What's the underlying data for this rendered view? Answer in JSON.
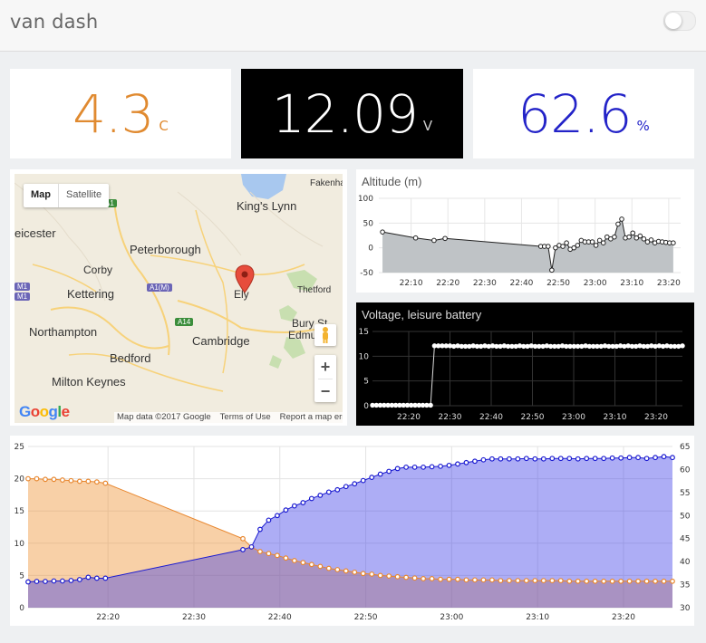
{
  "header": {
    "title": "van dash"
  },
  "stats": {
    "temperature": {
      "value": "4.3",
      "unit": "C",
      "color": "#e08a30"
    },
    "voltage": {
      "value": "12.09",
      "unit": "V",
      "color": "#ffffff",
      "bg": "#000000"
    },
    "humidity": {
      "value": "62.6",
      "unit": "%",
      "color": "#2323c8"
    }
  },
  "map": {
    "type_controls": {
      "map": "Map",
      "satellite": "Satellite"
    },
    "zoom_in": "+",
    "zoom_out": "−",
    "logo": [
      "G",
      "o",
      "o",
      "g",
      "l",
      "e"
    ],
    "footer": {
      "data": "Map data ©2017 Google",
      "terms": "Terms of Use",
      "report": "Report a map error"
    },
    "places": {
      "fakenham": "Fakenha",
      "kings_lynn": "King's Lynn",
      "leicester": "eicester",
      "peterborough": "Peterborough",
      "corby": "Corby",
      "kettering": "Kettering",
      "thetford": "Thetford",
      "ely": "Ely",
      "northampton": "Northampton",
      "bury": "Bury St",
      "bury2": "Edmu",
      "cambridge": "Cambridge",
      "bedford": "Bedford",
      "milton_keynes": "Milton Keynes"
    },
    "shields": {
      "a1": "A1",
      "a1m": "A1(M)",
      "a14": "A14",
      "m1": "M1",
      "m1b": "M1"
    }
  },
  "altitude": {
    "title": "Altitude (m)",
    "chart_data": {
      "type": "area",
      "title": "Altitude (m)",
      "ylim": [
        -50,
        100
      ],
      "yticks": [
        -50,
        0,
        50,
        100
      ],
      "xticks": [
        "22:10",
        "22:20",
        "22:30",
        "22:40",
        "22:50",
        "23:00",
        "23:10",
        "23:20"
      ],
      "x_minutes": [
        1,
        10,
        15,
        18,
        44,
        45,
        46,
        47,
        48,
        49,
        50,
        51,
        52,
        53,
        54,
        55,
        56,
        57,
        58,
        59,
        60,
        61,
        62,
        63,
        64,
        65,
        66,
        67,
        68,
        69,
        70,
        71,
        72,
        73,
        74,
        75,
        76,
        77,
        78,
        79,
        80
      ],
      "values": [
        32,
        20,
        15,
        19,
        3,
        3,
        3,
        -45,
        0,
        5,
        3,
        10,
        -3,
        0,
        5,
        15,
        12,
        12,
        12,
        5,
        15,
        10,
        22,
        18,
        22,
        48,
        58,
        20,
        22,
        30,
        20,
        24,
        18,
        12,
        16,
        10,
        13,
        12,
        11,
        10,
        10
      ]
    }
  },
  "voltage_chart": {
    "title": "Voltage, leisure battery",
    "chart_data": {
      "type": "line",
      "title": "Voltage, leisure battery",
      "ylim": [
        0,
        15
      ],
      "yticks": [
        0,
        5,
        10,
        15
      ],
      "xticks": [
        "22:20",
        "22:30",
        "22:40",
        "22:50",
        "23:00",
        "23:10",
        "23:20"
      ],
      "series": [
        {
          "x_minutes": [
            0,
            0.5,
            1,
            1.5,
            2,
            2.5,
            3,
            3.5,
            4,
            4.5,
            5,
            5.5,
            6,
            6.5,
            7,
            7.5,
            8,
            8.5,
            9,
            9.5,
            10,
            10.5,
            11,
            11.5,
            12,
            12.5,
            13,
            13.5,
            14,
            14.5,
            15,
            15.5,
            16,
            16.5,
            17,
            17.5,
            18,
            18.5,
            19,
            19.5,
            20,
            20.5,
            21,
            21.5,
            22,
            22.5,
            23,
            23.5,
            24,
            24.5,
            25,
            25.5,
            26,
            26.5,
            27,
            27.5,
            28,
            28.5,
            29,
            29.5,
            30,
            30.5,
            31,
            31.5,
            32,
            32.5,
            33,
            33.5,
            34,
            34.5,
            35,
            35.5,
            36,
            36.5,
            37,
            37.5,
            38,
            38.5,
            39,
            39.5,
            40
          ],
          "values": [
            0.1,
            0.1,
            0.1,
            0.1,
            0.1,
            0.1,
            0.1,
            0.1,
            0.1,
            0.1,
            0.1,
            0.1,
            0.1,
            0.1,
            0.1,
            0.1,
            12.1,
            12.1,
            12.1,
            12.1,
            12.1,
            12.0,
            12.1,
            12.0,
            12.0,
            12.0,
            12.1,
            12.0,
            12.0,
            12.1,
            12.0,
            12.1,
            12.0,
            12.0,
            12.1,
            12.0,
            12.0,
            12.0,
            12.1,
            12.0,
            12.0,
            12.1,
            12.0,
            12.0,
            12.0,
            12.1,
            12.0,
            12.0,
            12.0,
            12.1,
            12.0,
            12.0,
            12.0,
            12.0,
            12.0,
            12.1,
            12.0,
            12.0,
            12.0,
            12.0,
            12.1,
            12.0,
            12.0,
            12.0,
            12.1,
            12.0,
            12.1,
            12.0,
            12.0,
            12.1,
            12.0,
            12.0,
            12.1,
            12.0,
            12.1,
            12.0,
            12.1,
            12.0,
            12.0,
            12.0,
            12.1
          ]
        }
      ]
    }
  },
  "climate": {
    "chart_data": {
      "type": "area",
      "yticks_left": [
        0,
        5,
        10,
        15,
        20,
        25
      ],
      "yticks_right": [
        30,
        35,
        40,
        45,
        50,
        55,
        60,
        65
      ],
      "ylim_left": [
        0,
        25
      ],
      "ylim_right": [
        30,
        65
      ],
      "xticks": [
        "22:20",
        "22:30",
        "22:40",
        "22:50",
        "23:00",
        "23:10",
        "23:20"
      ],
      "colors": {
        "temperature": "#e8872f",
        "humidity": "#1a1ad0"
      },
      "series": [
        {
          "axis": "left",
          "x_minutes": [
            10,
            11,
            12,
            13,
            14,
            15,
            16,
            17,
            18,
            19,
            35,
            36,
            37,
            38,
            39,
            40,
            41,
            42,
            43,
            44,
            45,
            46,
            47,
            48,
            49,
            50,
            51,
            52,
            53,
            54,
            55,
            56,
            57,
            58,
            59,
            60,
            61,
            62,
            63,
            64,
            65,
            66,
            67,
            68,
            69,
            70,
            71,
            72,
            73,
            74,
            75,
            76,
            77,
            78,
            79,
            80,
            81,
            82,
            83,
            84,
            85
          ],
          "values": [
            20,
            20,
            19.9,
            19.9,
            19.8,
            19.7,
            19.6,
            19.6,
            19.5,
            19.3,
            10.7,
            9.4,
            8.7,
            8.4,
            8.1,
            7.7,
            7.3,
            7.0,
            6.7,
            6.4,
            6.1,
            5.9,
            5.7,
            5.5,
            5.3,
            5.2,
            5.0,
            4.9,
            4.8,
            4.7,
            4.6,
            4.5,
            4.5,
            4.4,
            4.4,
            4.4,
            4.3,
            4.3,
            4.3,
            4.3,
            4.2,
            4.2,
            4.2,
            4.2,
            4.2,
            4.2,
            4.2,
            4.2,
            4.1,
            4.1,
            4.1,
            4.1,
            4.1,
            4.1,
            4.1,
            4.1,
            4.1,
            4.1,
            4.1,
            4.1,
            4.1
          ]
        },
        {
          "axis": "right",
          "x_minutes": [
            10,
            11,
            12,
            13,
            14,
            15,
            16,
            17,
            18,
            19,
            35,
            36,
            37,
            38,
            39,
            40,
            41,
            42,
            43,
            44,
            45,
            46,
            47,
            48,
            49,
            50,
            51,
            52,
            53,
            54,
            55,
            56,
            57,
            58,
            59,
            60,
            61,
            62,
            63,
            64,
            65,
            66,
            67,
            68,
            69,
            70,
            71,
            72,
            73,
            74,
            75,
            76,
            77,
            78,
            79,
            80,
            81,
            82,
            83,
            84,
            85
          ],
          "values": [
            35.6,
            35.7,
            35.7,
            35.8,
            35.8,
            35.9,
            36.1,
            36.6,
            36.4,
            36.4,
            42.6,
            43.2,
            47.0,
            49.0,
            50.0,
            51.2,
            52.1,
            52.8,
            53.7,
            54.4,
            55.1,
            55.6,
            56.3,
            56.9,
            57.6,
            58.3,
            59.0,
            59.6,
            60.2,
            60.5,
            60.5,
            60.5,
            60.6,
            60.7,
            60.9,
            61.2,
            61.5,
            61.8,
            62.1,
            62.3,
            62.3,
            62.3,
            62.3,
            62.4,
            62.3,
            62.3,
            62.4,
            62.4,
            62.4,
            62.3,
            62.4,
            62.4,
            62.4,
            62.5,
            62.5,
            62.6,
            62.6,
            62.4,
            62.6,
            62.8,
            62.6
          ]
        }
      ]
    }
  }
}
